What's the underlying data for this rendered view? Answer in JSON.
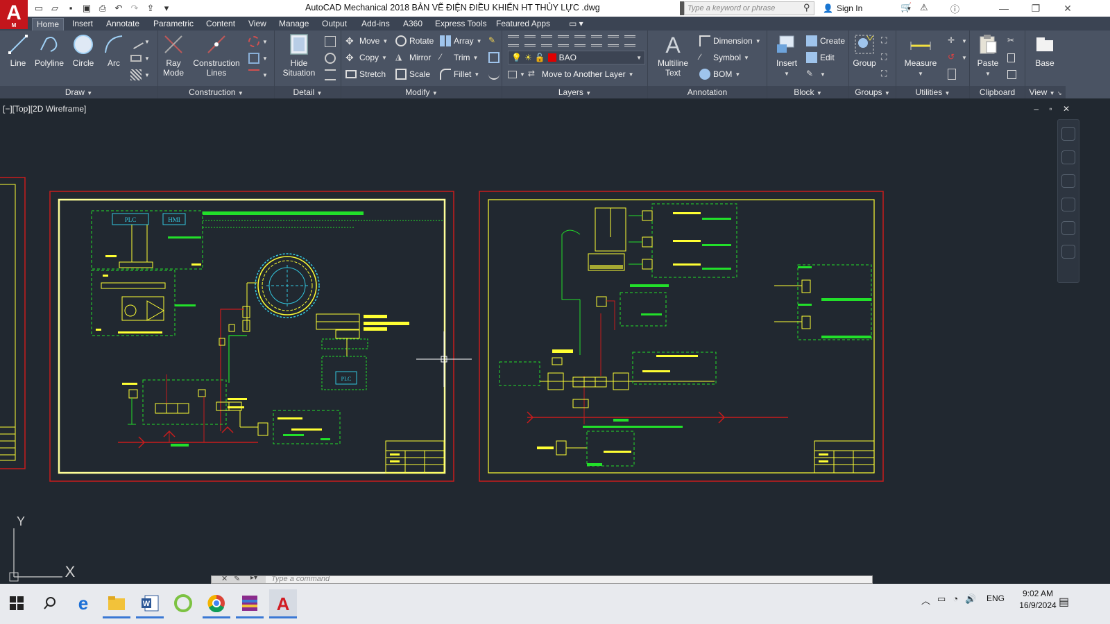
{
  "app": {
    "logo_letter": "A",
    "logo_sub": "M",
    "window_title": "AutoCAD Mechanical 2018    BẢN VẼ ĐIỆN ĐIỀU KHIỂN HT THỦY LỰC .dwg",
    "search_placeholder": "Type a keyword or phrase",
    "sign_in": "Sign In"
  },
  "ribbon_tabs": [
    "Home",
    "Insert",
    "Annotate",
    "Parametric",
    "Content",
    "View",
    "Manage",
    "Output",
    "Add-ins",
    "A360",
    "Express Tools",
    "Featured Apps"
  ],
  "active_tab": "Home",
  "draw_panel": {
    "label": "Draw",
    "line": "Line",
    "polyline": "Polyline",
    "circle": "Circle",
    "arc": "Arc"
  },
  "construction_panel": {
    "label": "Construction",
    "ray_mode": [
      "Ray",
      "Mode"
    ],
    "construction_lines": [
      "Construction",
      "Lines"
    ]
  },
  "detail_panel": {
    "label": "Detail",
    "hide_situation": [
      "Hide",
      "Situation"
    ]
  },
  "modify_panel": {
    "label": "Modify",
    "move": "Move",
    "rotate": "Rotate",
    "array": "Array",
    "copy": "Copy",
    "mirror": "Mirror",
    "trim": "Trim",
    "stretch": "Stretch",
    "scale": "Scale",
    "fillet": "Fillet"
  },
  "layers_panel": {
    "label": "Layers",
    "current_layer": "BAO",
    "move_to_layer": "Move to Another Layer"
  },
  "annotation_panel": {
    "label": "Annotation",
    "multiline_text": [
      "Multiline",
      "Text"
    ],
    "dimension": "Dimension",
    "symbol": "Symbol",
    "bom": "BOM"
  },
  "block_panel": {
    "label": "Block",
    "insert": "Insert",
    "create": "Create",
    "edit": "Edit"
  },
  "groups_panel": {
    "label": "Groups",
    "group": "Group"
  },
  "utilities_panel": {
    "label": "Utilities",
    "measure": "Measure"
  },
  "clipboard_panel": {
    "label": "Clipboard",
    "paste": "Paste"
  },
  "view_panel": {
    "label": "View",
    "base": "Base"
  },
  "viewport": {
    "label": "[−][Top][2D Wireframe]",
    "ctrls": "–  ▫  ✕",
    "sheet1_labels": [
      "PLC",
      "HMI",
      "PLC"
    ],
    "axis_y": "Y",
    "axis_x": "X"
  },
  "command_line": {
    "placeholder": "Type a command"
  },
  "taskbar": {
    "lang": "ENG",
    "time": "9:02 AM",
    "date": "16/9/2024"
  },
  "colors": {
    "layer_bao": "#e00000",
    "drawing_yellow": "#ffff33",
    "drawing_green": "#22e02a",
    "drawing_cyan": "#33c8e0",
    "border_red": "#c81c1c"
  }
}
